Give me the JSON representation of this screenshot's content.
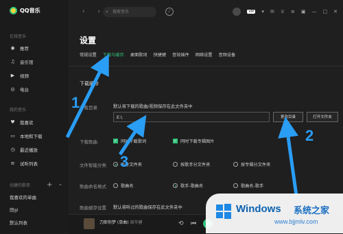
{
  "app": {
    "name": "QQ音乐"
  },
  "sidebar": {
    "sections": [
      {
        "title": "在线音乐",
        "items": [
          {
            "label": "推荐",
            "icon": "recommend-icon"
          },
          {
            "label": "音乐馆",
            "icon": "music-hall-icon"
          },
          {
            "label": "视频",
            "icon": "video-icon"
          },
          {
            "label": "电台",
            "icon": "radio-icon"
          }
        ]
      },
      {
        "title": "我的音乐",
        "items": [
          {
            "label": "我喜欢",
            "icon": "heart-icon"
          },
          {
            "label": "本地和下载",
            "icon": "computer-icon"
          },
          {
            "label": "最近播放",
            "icon": "clock-icon"
          },
          {
            "label": "试听列表",
            "icon": "playlist-icon"
          }
        ]
      },
      {
        "title": "创建的歌单",
        "items": [
          {
            "label": "我喜欢的单曲"
          },
          {
            "label": "田gi"
          },
          {
            "label": "默认列表"
          }
        ]
      }
    ]
  },
  "topbar": {
    "search_placeholder": "搜索音乐",
    "vip_label": "VIP"
  },
  "settings": {
    "title": "设置",
    "tabs": [
      "常规设置",
      "下载与缓存",
      "桌面歌词",
      "快捷键",
      "音效插件",
      "网络设置",
      "音频设备"
    ],
    "active_tab": "下载与缓存",
    "section_title": "下载缓存",
    "download_dir": {
      "label": "下载目录",
      "description": "默认将下载的歌曲/视频保存在此文件夹中",
      "path": "E:\\",
      "change_button": "更改目录",
      "open_button": "打开文件夹"
    },
    "download_songs": {
      "label": "下载歌曲",
      "options": [
        {
          "label": "同时下载歌词",
          "checked": true
        },
        {
          "label": "同时下载专辑图片",
          "checked": true
        }
      ]
    },
    "file_smart": {
      "label": "文件智能分类",
      "options": [
        {
          "label": "不分文件夹",
          "checked": true
        },
        {
          "label": "按歌手分文件夹",
          "checked": false
        },
        {
          "label": "按专辑分文件夹",
          "checked": false
        }
      ]
    },
    "naming": {
      "label": "歌曲命名格式",
      "options": [
        {
          "label": "歌曲名",
          "checked": false
        },
        {
          "label": "歌手-歌曲名",
          "checked": true
        },
        {
          "label": "歌曲名-歌手",
          "checked": false
        }
      ]
    },
    "cache": {
      "label": "歌曲缓存设置",
      "description": "默认将听过的歌曲保存在此文件夹中"
    }
  },
  "player": {
    "song": "刀郎你梦 (单曲)",
    "artist": "周华健"
  },
  "annotations": {
    "step1": "1",
    "step2": "2",
    "step3": "3",
    "arrow_color": "#2a9df4"
  },
  "watermark": {
    "brand": "Windows",
    "cn": "系统之家",
    "url": "www.bjjmlv.com"
  },
  "colors": {
    "accent": "#31c27c",
    "background": "#1f1f1f"
  }
}
